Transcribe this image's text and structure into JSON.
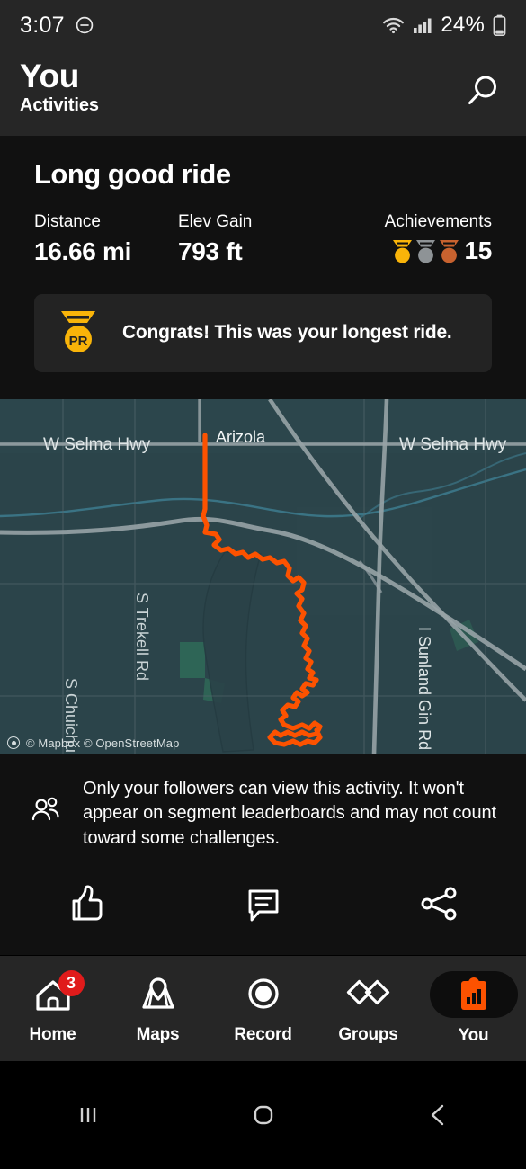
{
  "status_bar": {
    "time": "3:07",
    "dnd_icon": "do-not-disturb-icon",
    "wifi_icon": "wifi-icon",
    "signal_icon": "cellular-signal-icon",
    "battery_percent": "24%",
    "battery_icon": "battery-low-icon"
  },
  "header": {
    "title": "You",
    "subtitle": "Activities",
    "search_icon": "search-icon"
  },
  "activity": {
    "name": "Long good ride",
    "stats": [
      {
        "label": "Distance",
        "value": "16.66 mi"
      },
      {
        "label": "Elev Gain",
        "value": "793 ft"
      }
    ],
    "achievements": {
      "label": "Achievements",
      "count": "15",
      "medals": [
        "gold",
        "silver",
        "bronze"
      ]
    },
    "pr_banner": {
      "icon": "pr-badge-icon",
      "text": "Congrats! This was your longest ride."
    }
  },
  "map": {
    "labels": [
      {
        "text": "W Selma Hwy"
      },
      {
        "text": "Arizola"
      },
      {
        "text": "W Selma Hwy"
      },
      {
        "text": "S Trekell Rd"
      },
      {
        "text": "S Chuichu"
      },
      {
        "text": "I Sunland Gin Rd"
      }
    ],
    "attribution": "© Mapbox © OpenStreetMap",
    "route_color": "#FC5200",
    "base_color": "#2b444a"
  },
  "privacy": {
    "icon": "followers-icon",
    "text": "Only your followers can view this activity. It won't appear on segment leaderboards and may not count toward some challenges."
  },
  "actions": [
    {
      "name": "like",
      "icon": "thumbs-up-icon"
    },
    {
      "name": "comment",
      "icon": "comment-icon"
    },
    {
      "name": "share",
      "icon": "share-icon"
    }
  ],
  "bottom_nav": {
    "items": [
      {
        "label": "Home",
        "icon": "home-icon",
        "badge": "3",
        "active": false
      },
      {
        "label": "Maps",
        "icon": "map-pin-icon",
        "badge": "",
        "active": false
      },
      {
        "label": "Record",
        "icon": "record-icon",
        "badge": "",
        "active": false
      },
      {
        "label": "Groups",
        "icon": "groups-icon",
        "badge": "",
        "active": false
      },
      {
        "label": "You",
        "icon": "clipboard-icon",
        "badge": "",
        "active": true
      }
    ],
    "accent_color": "#FC5200"
  },
  "system_nav": {
    "recents_icon": "recents-icon",
    "home_icon": "home-square-icon",
    "back_icon": "back-chevron-icon"
  }
}
